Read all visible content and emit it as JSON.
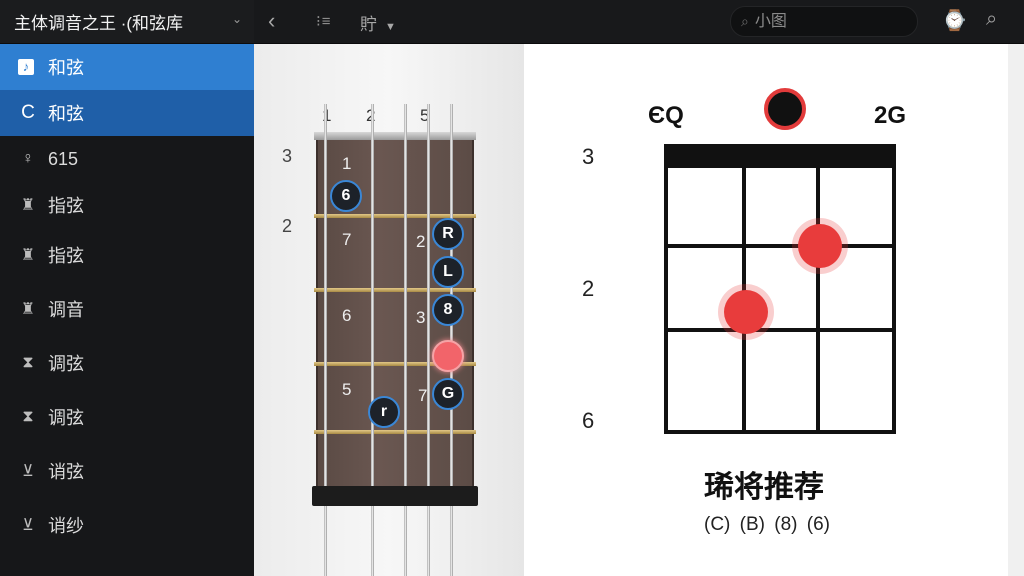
{
  "sidebar": {
    "title": "主体调音之王 ·(和弦库",
    "items": [
      {
        "icon": "♪",
        "icon_name": "chord-icon",
        "label": "和弦"
      },
      {
        "icon": "C",
        "icon_name": "c-key-icon",
        "label": "和弦"
      },
      {
        "icon": "♀",
        "icon_name": "key-icon",
        "label": "615"
      },
      {
        "icon": "♜",
        "icon_name": "tuner-icon",
        "label": "指弦"
      },
      {
        "icon": "♜",
        "icon_name": "tuner-icon",
        "label": "指弦"
      },
      {
        "icon": "♜",
        "icon_name": "tuner-icon",
        "label": "调音"
      },
      {
        "icon": "⧗",
        "icon_name": "tuner-icon",
        "label": "调弦"
      },
      {
        "icon": "⧗",
        "icon_name": "tuner-icon",
        "label": "调弦"
      },
      {
        "icon": "⊻",
        "icon_name": "tuner-icon",
        "label": "诮弦"
      },
      {
        "icon": "⊻",
        "icon_name": "tuner-icon",
        "label": "诮纱"
      }
    ]
  },
  "toolbar": {
    "back_icon": "‹",
    "icon2": "⁝≡",
    "view_label": "貯",
    "search_placeholder": "小图",
    "btn1_icon": "⌚",
    "btn2_icon": "⌕"
  },
  "fretboard": {
    "top_labels": [
      "1",
      "2",
      "5"
    ],
    "side_labels": [
      "3",
      "2"
    ],
    "fret_numbers": [
      "1",
      "7",
      "6",
      "5",
      "2",
      "3",
      "7"
    ],
    "dots": [
      "6",
      "R",
      "L",
      "8",
      "",
      "G",
      "r"
    ]
  },
  "chord_diagram": {
    "left_label": "ЄQ",
    "right_label": "2G",
    "side_labels": [
      "3",
      "2",
      "6"
    ],
    "title": "琋将推荐",
    "fingers": "(C) (B)  (8) (6)",
    "accent_color": "#e83c3c"
  }
}
